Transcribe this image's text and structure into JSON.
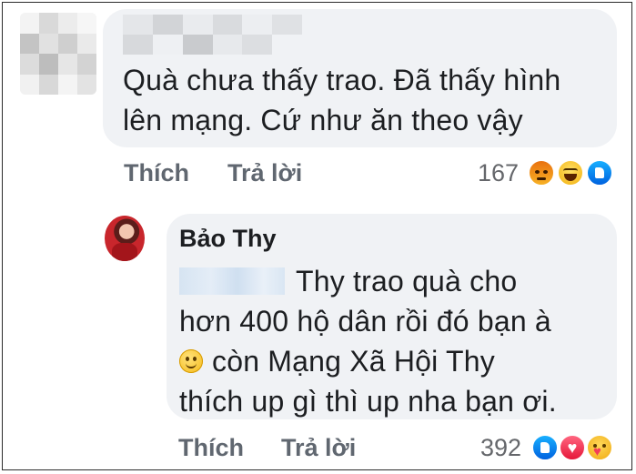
{
  "comment1": {
    "author_hidden": true,
    "text_line1": "Quà chưa thấy trao. Đã thấy hình",
    "text_line2": "lên mạng. Cứ như ăn theo vậy",
    "actions": {
      "like_label": "Thích",
      "reply_label": "Trả lời"
    },
    "reaction_count": "167",
    "reactions": [
      "angry-reaction-icon",
      "haha-reaction-icon",
      "like-reaction-icon"
    ]
  },
  "comment2": {
    "author": "Bảo Thy",
    "mention_hidden": true,
    "text_line1": "Thy trao quà cho",
    "text_line2": "hơn 400 hộ dân rồi đó bạn à",
    "text_line3": "còn Mạng Xã Hội Thy",
    "text_line4": "thích up gì thì up nha bạn ơi.",
    "emoji": "smile-emoji-icon",
    "actions": {
      "like_label": "Thích",
      "reply_label": "Trả lời"
    },
    "reaction_count": "392",
    "reactions": [
      "like-reaction-icon",
      "love-reaction-icon",
      "care-reaction-icon"
    ]
  },
  "colors": {
    "bubble": "#f0f2f5",
    "text": "#1c1e21",
    "action_text": "#606770",
    "like_blue": "#0062df",
    "love_red": "#e61739"
  }
}
